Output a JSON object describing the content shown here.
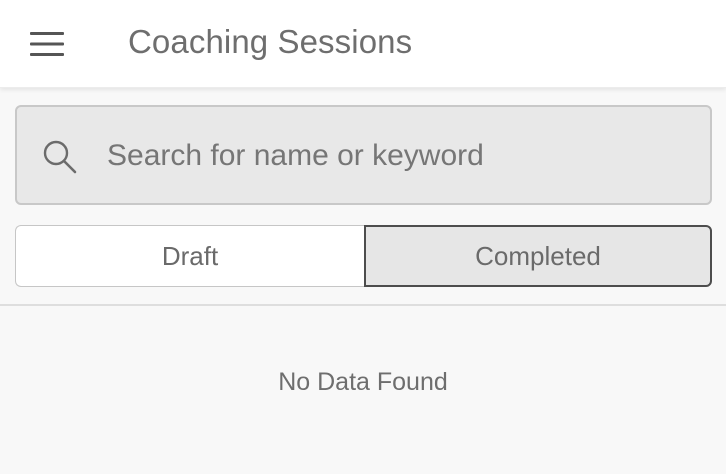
{
  "header": {
    "menu_icon": "hamburger-menu-icon",
    "title": "Coaching Sessions"
  },
  "search": {
    "icon": "search-icon",
    "placeholder": "Search for name or keyword",
    "value": ""
  },
  "tabs": [
    {
      "label": "Draft",
      "selected": false
    },
    {
      "label": "Completed",
      "selected": true
    }
  ],
  "content": {
    "empty_message": "No Data Found"
  },
  "colors": {
    "app_bar": "#ffffff",
    "background": "#f8f8f8",
    "search_bg": "#e8e8e8",
    "selected_tab_bg": "#e6e6e6",
    "selected_tab_border": "#4d4d4d",
    "text_gray": "#6e6e6e"
  }
}
